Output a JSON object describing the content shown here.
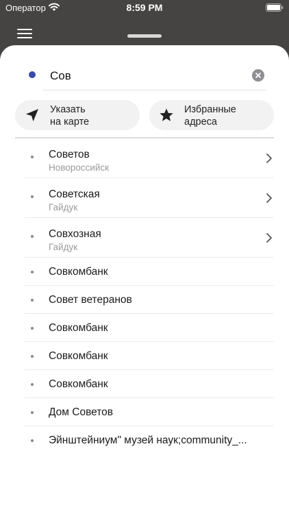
{
  "status_bar": {
    "carrier": "Оператор",
    "time": "8:59 PM"
  },
  "search": {
    "value": "Сов"
  },
  "chips": [
    {
      "label": "Указать\nна карте",
      "icon": "location-arrow-icon"
    },
    {
      "label": "Избранные\nадреса",
      "icon": "star-icon"
    }
  ],
  "results": [
    {
      "title": "Советов",
      "subtitle": "Новороссийск",
      "has_chevron": true
    },
    {
      "title": "Советская",
      "subtitle": "Гайдук",
      "has_chevron": true
    },
    {
      "title": "Совхозная",
      "subtitle": "Гайдук",
      "has_chevron": true
    },
    {
      "title": "Совкомбанк"
    },
    {
      "title": "Совет ветеранов"
    },
    {
      "title": "Совкомбанк"
    },
    {
      "title": "Совкомбанк"
    },
    {
      "title": "Совкомбанк"
    },
    {
      "title": "Дом Советов"
    },
    {
      "title": "Эйнштейниум\" музей наук;community_..."
    }
  ],
  "colors": {
    "accent_dot": "#3b4ba8",
    "header_bg": "#454442"
  }
}
